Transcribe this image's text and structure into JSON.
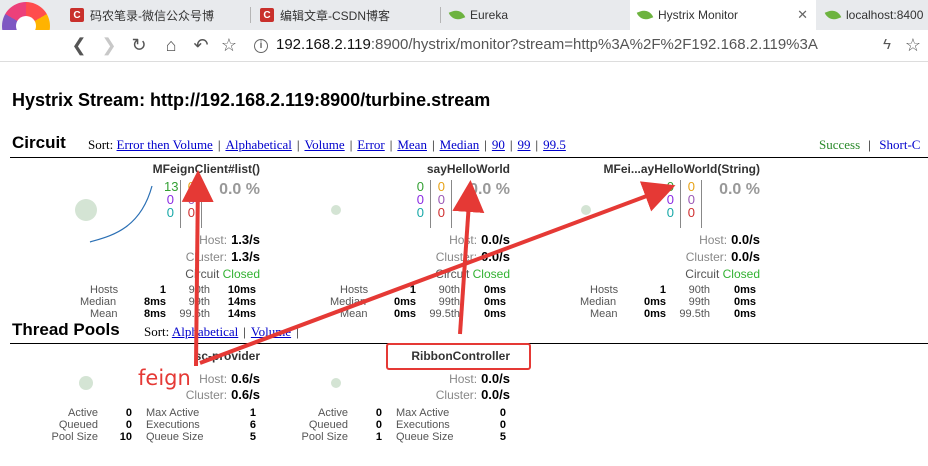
{
  "browser": {
    "tabs": [
      {
        "title": "码农笔录-微信公众号博",
        "icon": "csdn-icon"
      },
      {
        "title": "编辑文章-CSDN博客",
        "icon": "csdn-icon"
      },
      {
        "title": "Eureka",
        "icon": "spring-leaf-icon"
      },
      {
        "title": "Hystrix Monitor",
        "icon": "spring-leaf-icon",
        "active": true
      },
      {
        "title": "localhost:8400",
        "icon": "spring-leaf-icon"
      }
    ],
    "url_host": "192.168.2.119",
    "url_rest": ":8900/hystrix/monitor?stream=http%3A%2F%2F192.168.2.119%3A"
  },
  "page": {
    "title": "Hystrix Stream: http://192.168.2.119:8900/turbine.stream"
  },
  "circuit_section": {
    "title": "Circuit",
    "sort_label": "Sort:",
    "sort_links": [
      "Error then Volume",
      "Alphabetical",
      "Volume",
      "Error",
      "Mean",
      "Median",
      "90",
      "99",
      "99.5"
    ],
    "legend_success": "Success",
    "legend_short": "Short-C"
  },
  "circuits": [
    {
      "name": "MFeignClient#list()",
      "counts": {
        "success": "13",
        "short": "0",
        "bad": "0",
        "timeout": "0",
        "rejected": "0",
        "failure": "0"
      },
      "error_pct": "0.0 %",
      "host_label": "Host:",
      "host_rate": "1.3/s",
      "cluster_label": "Cluster:",
      "cluster_rate": "1.3/s",
      "circuit_label": "Circuit",
      "circuit_status": "Closed",
      "metrics": {
        "hosts_label": "Hosts",
        "hosts": "1",
        "p90_label": "90th",
        "p90": "10ms",
        "median_label": "Median",
        "median": "8ms",
        "p99_label": "99th",
        "p99": "14ms",
        "mean_label": "Mean",
        "mean": "8ms",
        "p995_label": "99.5th",
        "p995": "14ms"
      }
    },
    {
      "name": "sayHelloWorld",
      "counts": {
        "success": "0",
        "short": "0",
        "bad": "0",
        "timeout": "0",
        "rejected": "0",
        "failure": "0"
      },
      "error_pct": "0.0 %",
      "host_label": "Host:",
      "host_rate": "0.0/s",
      "cluster_label": "Cluster:",
      "cluster_rate": "0.0/s",
      "circuit_label": "Circuit",
      "circuit_status": "Closed",
      "metrics": {
        "hosts_label": "Hosts",
        "hosts": "1",
        "p90_label": "90th",
        "p90": "0ms",
        "median_label": "Median",
        "median": "0ms",
        "p99_label": "99th",
        "p99": "0ms",
        "mean_label": "Mean",
        "mean": "0ms",
        "p995_label": "99.5th",
        "p995": "0ms"
      }
    },
    {
      "name": "MFei...ayHelloWorld(String)",
      "counts": {
        "success": "0",
        "short": "0",
        "bad": "0",
        "timeout": "0",
        "rejected": "0",
        "failure": "0"
      },
      "error_pct": "0.0 %",
      "host_label": "Host:",
      "host_rate": "0.0/s",
      "cluster_label": "Cluster:",
      "cluster_rate": "0.0/s",
      "circuit_label": "Circuit",
      "circuit_status": "Closed",
      "metrics": {
        "hosts_label": "Hosts",
        "hosts": "1",
        "p90_label": "90th",
        "p90": "0ms",
        "median_label": "Median",
        "median": "0ms",
        "p99_label": "99th",
        "p99": "0ms",
        "mean_label": "Mean",
        "mean": "0ms",
        "p995_label": "99.5th",
        "p995": "0ms"
      }
    }
  ],
  "pool_section": {
    "title": "Thread Pools",
    "sort_label": "Sort:",
    "sort_links": [
      "Alphabetical",
      "Volume"
    ]
  },
  "pools": [
    {
      "name": "sc-provider",
      "host_label": "Host:",
      "host_rate": "0.6/s",
      "cluster_label": "Cluster:",
      "cluster_rate": "0.6/s",
      "stats": {
        "active_label": "Active",
        "active": "0",
        "max_active_label": "Max Active",
        "max_active": "1",
        "queued_label": "Queued",
        "queued": "0",
        "executions_label": "Executions",
        "executions": "6",
        "pool_size_label": "Pool Size",
        "pool_size": "10",
        "queue_size_label": "Queue Size",
        "queue_size": "5"
      }
    },
    {
      "name": "RibbonController",
      "host_label": "Host:",
      "host_rate": "0.0/s",
      "cluster_label": "Cluster:",
      "cluster_rate": "0.0/s",
      "stats": {
        "active_label": "Active",
        "active": "0",
        "max_active_label": "Max Active",
        "max_active": "0",
        "queued_label": "Queued",
        "queued": "0",
        "executions_label": "Executions",
        "executions": "0",
        "pool_size_label": "Pool Size",
        "pool_size": "1",
        "queue_size_label": "Queue Size",
        "queue_size": "5"
      }
    }
  ],
  "annotation": {
    "label": "feign",
    "color": "#e53935"
  },
  "colors": {
    "success": "#33a033",
    "short_circuited": "#2a6fb4",
    "bad_request": "#8a2be2",
    "timeout": "#e8a317",
    "rejected": "#9b59b6",
    "failure": "#d03030",
    "circuit_closed": "#33b233",
    "link": "#0000cc"
  }
}
